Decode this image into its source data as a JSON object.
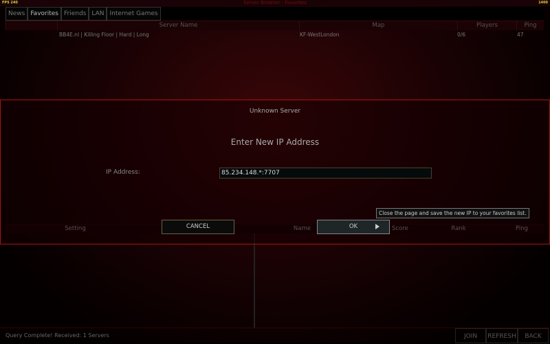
{
  "topbar": {
    "fps": "FPS 240",
    "counter": "1400",
    "title": "Server Browser : Favorites"
  },
  "tabs": [
    {
      "label": "News"
    },
    {
      "label": "Favorites",
      "active": true
    },
    {
      "label": "Friends"
    },
    {
      "label": "LAN"
    },
    {
      "label": "Internet Games"
    }
  ],
  "server_list": {
    "columns": [
      "",
      "Server Name",
      "Map",
      "Players",
      "Ping"
    ],
    "rows": [
      {
        "name": "BB4E.nl | Killing Floor | Hard | Long",
        "map": "KF-WestLondon",
        "players": "0/6",
        "ping": "47"
      }
    ]
  },
  "details": {
    "columns": [
      "Setting",
      "Name",
      "Score",
      "Rank",
      "Ping"
    ]
  },
  "dialog": {
    "title": "Unknown Server",
    "heading": "Enter New IP Address",
    "ip_label": "IP Address:",
    "ip_value": "85.234.148.*:7707",
    "cancel": "CANCEL",
    "ok": "OK",
    "tooltip": "Close the page and save the new IP to your favorites list."
  },
  "status": {
    "text": "Query Complete! Received: 1 Servers"
  },
  "buttons": {
    "join": "JOIN",
    "refresh": "REFRESH",
    "back": "BACK"
  },
  "colors": {
    "accent": "#b01010"
  }
}
